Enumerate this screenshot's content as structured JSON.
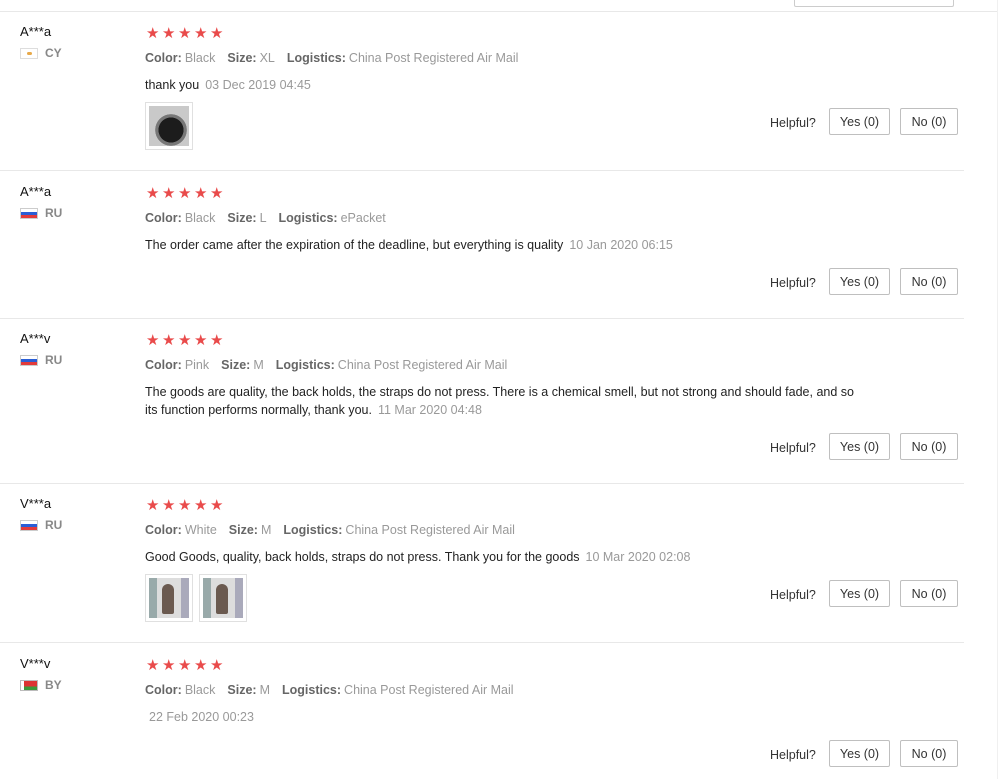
{
  "helpful_label": "Helpful?",
  "reviews": [
    {
      "user": "A***a",
      "country": "CY",
      "flag": "cy",
      "meta": [
        {
          "k": "Color:",
          "v": "Black"
        },
        {
          "k": "Size:",
          "v": "XL"
        },
        {
          "k": "Logistics:",
          "v": "China Post Registered Air Mail"
        }
      ],
      "text": "thank you",
      "date": "03 Dec 2019 04:45",
      "yes": "Yes (0)",
      "no": "No (0)",
      "rating": 5,
      "photos": 1
    },
    {
      "user": "A***a",
      "country": "RU",
      "flag": "ru",
      "meta": [
        {
          "k": "Color:",
          "v": "Black"
        },
        {
          "k": "Size:",
          "v": "L"
        },
        {
          "k": "Logistics:",
          "v": "ePacket"
        }
      ],
      "text": "The order came after the expiration of the deadline, but everything is quality",
      "date": "10 Jan 2020 06:15",
      "yes": "Yes (0)",
      "no": "No (0)",
      "rating": 5,
      "photos": 0
    },
    {
      "user": "A***v",
      "country": "RU",
      "flag": "ru",
      "meta": [
        {
          "k": "Color:",
          "v": "Pink"
        },
        {
          "k": "Size:",
          "v": "M"
        },
        {
          "k": "Logistics:",
          "v": "China Post Registered Air Mail"
        }
      ],
      "text": "The goods are quality, the back holds, the straps do not press. There is a chemical smell, but not strong and should fade, and so its function performs normally, thank you.",
      "date": "11 Mar 2020 04:48",
      "yes": "Yes (0)",
      "no": "No (0)",
      "rating": 5,
      "photos": 0
    },
    {
      "user": "V***a",
      "country": "RU",
      "flag": "ru",
      "meta": [
        {
          "k": "Color:",
          "v": "White"
        },
        {
          "k": "Size:",
          "v": "M"
        },
        {
          "k": "Logistics:",
          "v": "China Post Registered Air Mail"
        }
      ],
      "text": "Good Goods, quality, back holds, straps do not press. Thank you for the goods",
      "date": "10 Mar 2020 02:08",
      "yes": "Yes (0)",
      "no": "No (0)",
      "rating": 5,
      "photos": 2
    },
    {
      "user": "V***v",
      "country": "BY",
      "flag": "by",
      "meta": [
        {
          "k": "Color:",
          "v": "Black"
        },
        {
          "k": "Size:",
          "v": "M"
        },
        {
          "k": "Logistics:",
          "v": "China Post Registered Air Mail"
        }
      ],
      "text": "",
      "date": "22 Feb 2020 00:23",
      "yes": "Yes (0)",
      "no": "No (0)",
      "rating": 5,
      "photos": 0
    }
  ],
  "colors": {
    "star": "#e94b4b",
    "muted": "#999999",
    "divider": "#e8e8e8"
  },
  "icons": {
    "star": "star-icon",
    "flag": "flag-icon",
    "photo": "review-photo"
  }
}
